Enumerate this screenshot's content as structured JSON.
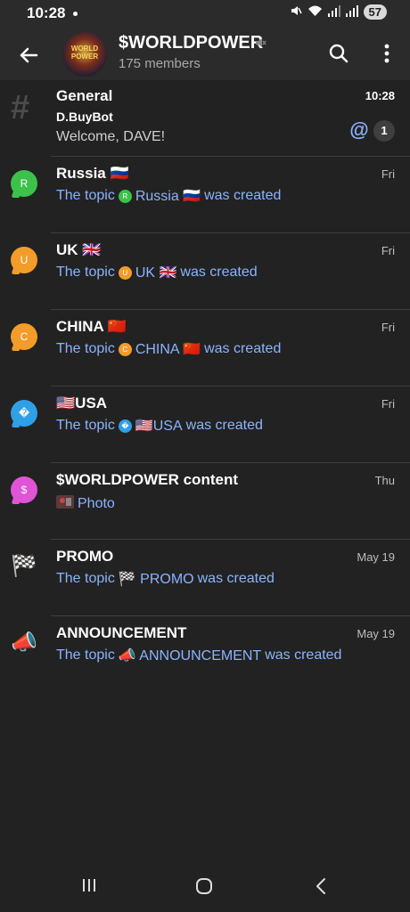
{
  "status": {
    "time": "10:28",
    "battery": "57"
  },
  "header": {
    "title": "$WORLDPOWER",
    "members": "175 members",
    "avatar_text": "WORLD POWER"
  },
  "topics": [
    {
      "title": "General",
      "time": "10:28",
      "sender": "D.BuyBot",
      "preview": "Welcome, DAVE!",
      "mention": "@",
      "unread": "1"
    },
    {
      "title": "Russia 🇷🇺",
      "time": "Fri",
      "icon_letter": "R",
      "icon_color": "#3cc24a",
      "msg_prefix": "The topic",
      "msg_topic": "Russia 🇷🇺",
      "msg_suffix": "was created"
    },
    {
      "title": "UK 🇬🇧",
      "time": "Fri",
      "icon_letter": "U",
      "icon_color": "#f39c2a",
      "msg_prefix": "The topic",
      "msg_topic": "UK 🇬🇧",
      "msg_suffix": "was created"
    },
    {
      "title": "CHINA 🇨🇳",
      "time": "Fri",
      "icon_letter": "C",
      "icon_color": "#f39c2a",
      "msg_prefix": "The topic",
      "msg_topic": "CHINA 🇨🇳",
      "msg_suffix": "was created"
    },
    {
      "title": "🇺🇸USA",
      "time": "Fri",
      "icon_letter": "�",
      "icon_color": "#2f9fe6",
      "msg_prefix": "The topic",
      "msg_topic": "🇺🇸USA",
      "msg_suffix": "was created"
    },
    {
      "title": "$WORLDPOWER content",
      "time": "Thu",
      "icon_letter": "$",
      "icon_color": "#e055d6",
      "msg": "Photo"
    },
    {
      "title": "PROMO",
      "time": "May 19",
      "icon_emoji": "🏁",
      "msg_prefix": "The topic",
      "msg_topic": "🏁 PROMO",
      "msg_suffix": "was created"
    },
    {
      "title": "ANNOUNCEMENT",
      "time": "May 19",
      "icon_emoji": "📣",
      "msg_prefix": "The topic",
      "msg_topic": "📣 ANNOUNCEMENT",
      "msg_suffix": "was created"
    }
  ],
  "colors": {
    "background": "#222222",
    "header": "#2b2b2b",
    "link": "#8ab4ff"
  }
}
